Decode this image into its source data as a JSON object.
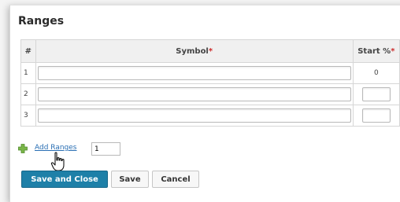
{
  "section": {
    "title": "Ranges"
  },
  "table": {
    "columns": {
      "index": "#",
      "symbol": "Symbol",
      "start": "Start %",
      "required_mark": "*"
    },
    "rows": [
      {
        "index": "1",
        "symbol": "",
        "start": "0",
        "start_editable": false
      },
      {
        "index": "2",
        "symbol": "",
        "start": "",
        "start_editable": true
      },
      {
        "index": "3",
        "symbol": "",
        "start": "",
        "start_editable": true
      }
    ]
  },
  "add_ranges": {
    "link_label": "Add Ranges",
    "count": "1"
  },
  "buttons": {
    "save_close": "Save and Close",
    "save": "Save",
    "cancel": "Cancel"
  },
  "colors": {
    "primary_button": "#1e80a8",
    "link": "#2a6fb4",
    "required": "#cc2b2b",
    "plus_icon": "#7ab648"
  }
}
